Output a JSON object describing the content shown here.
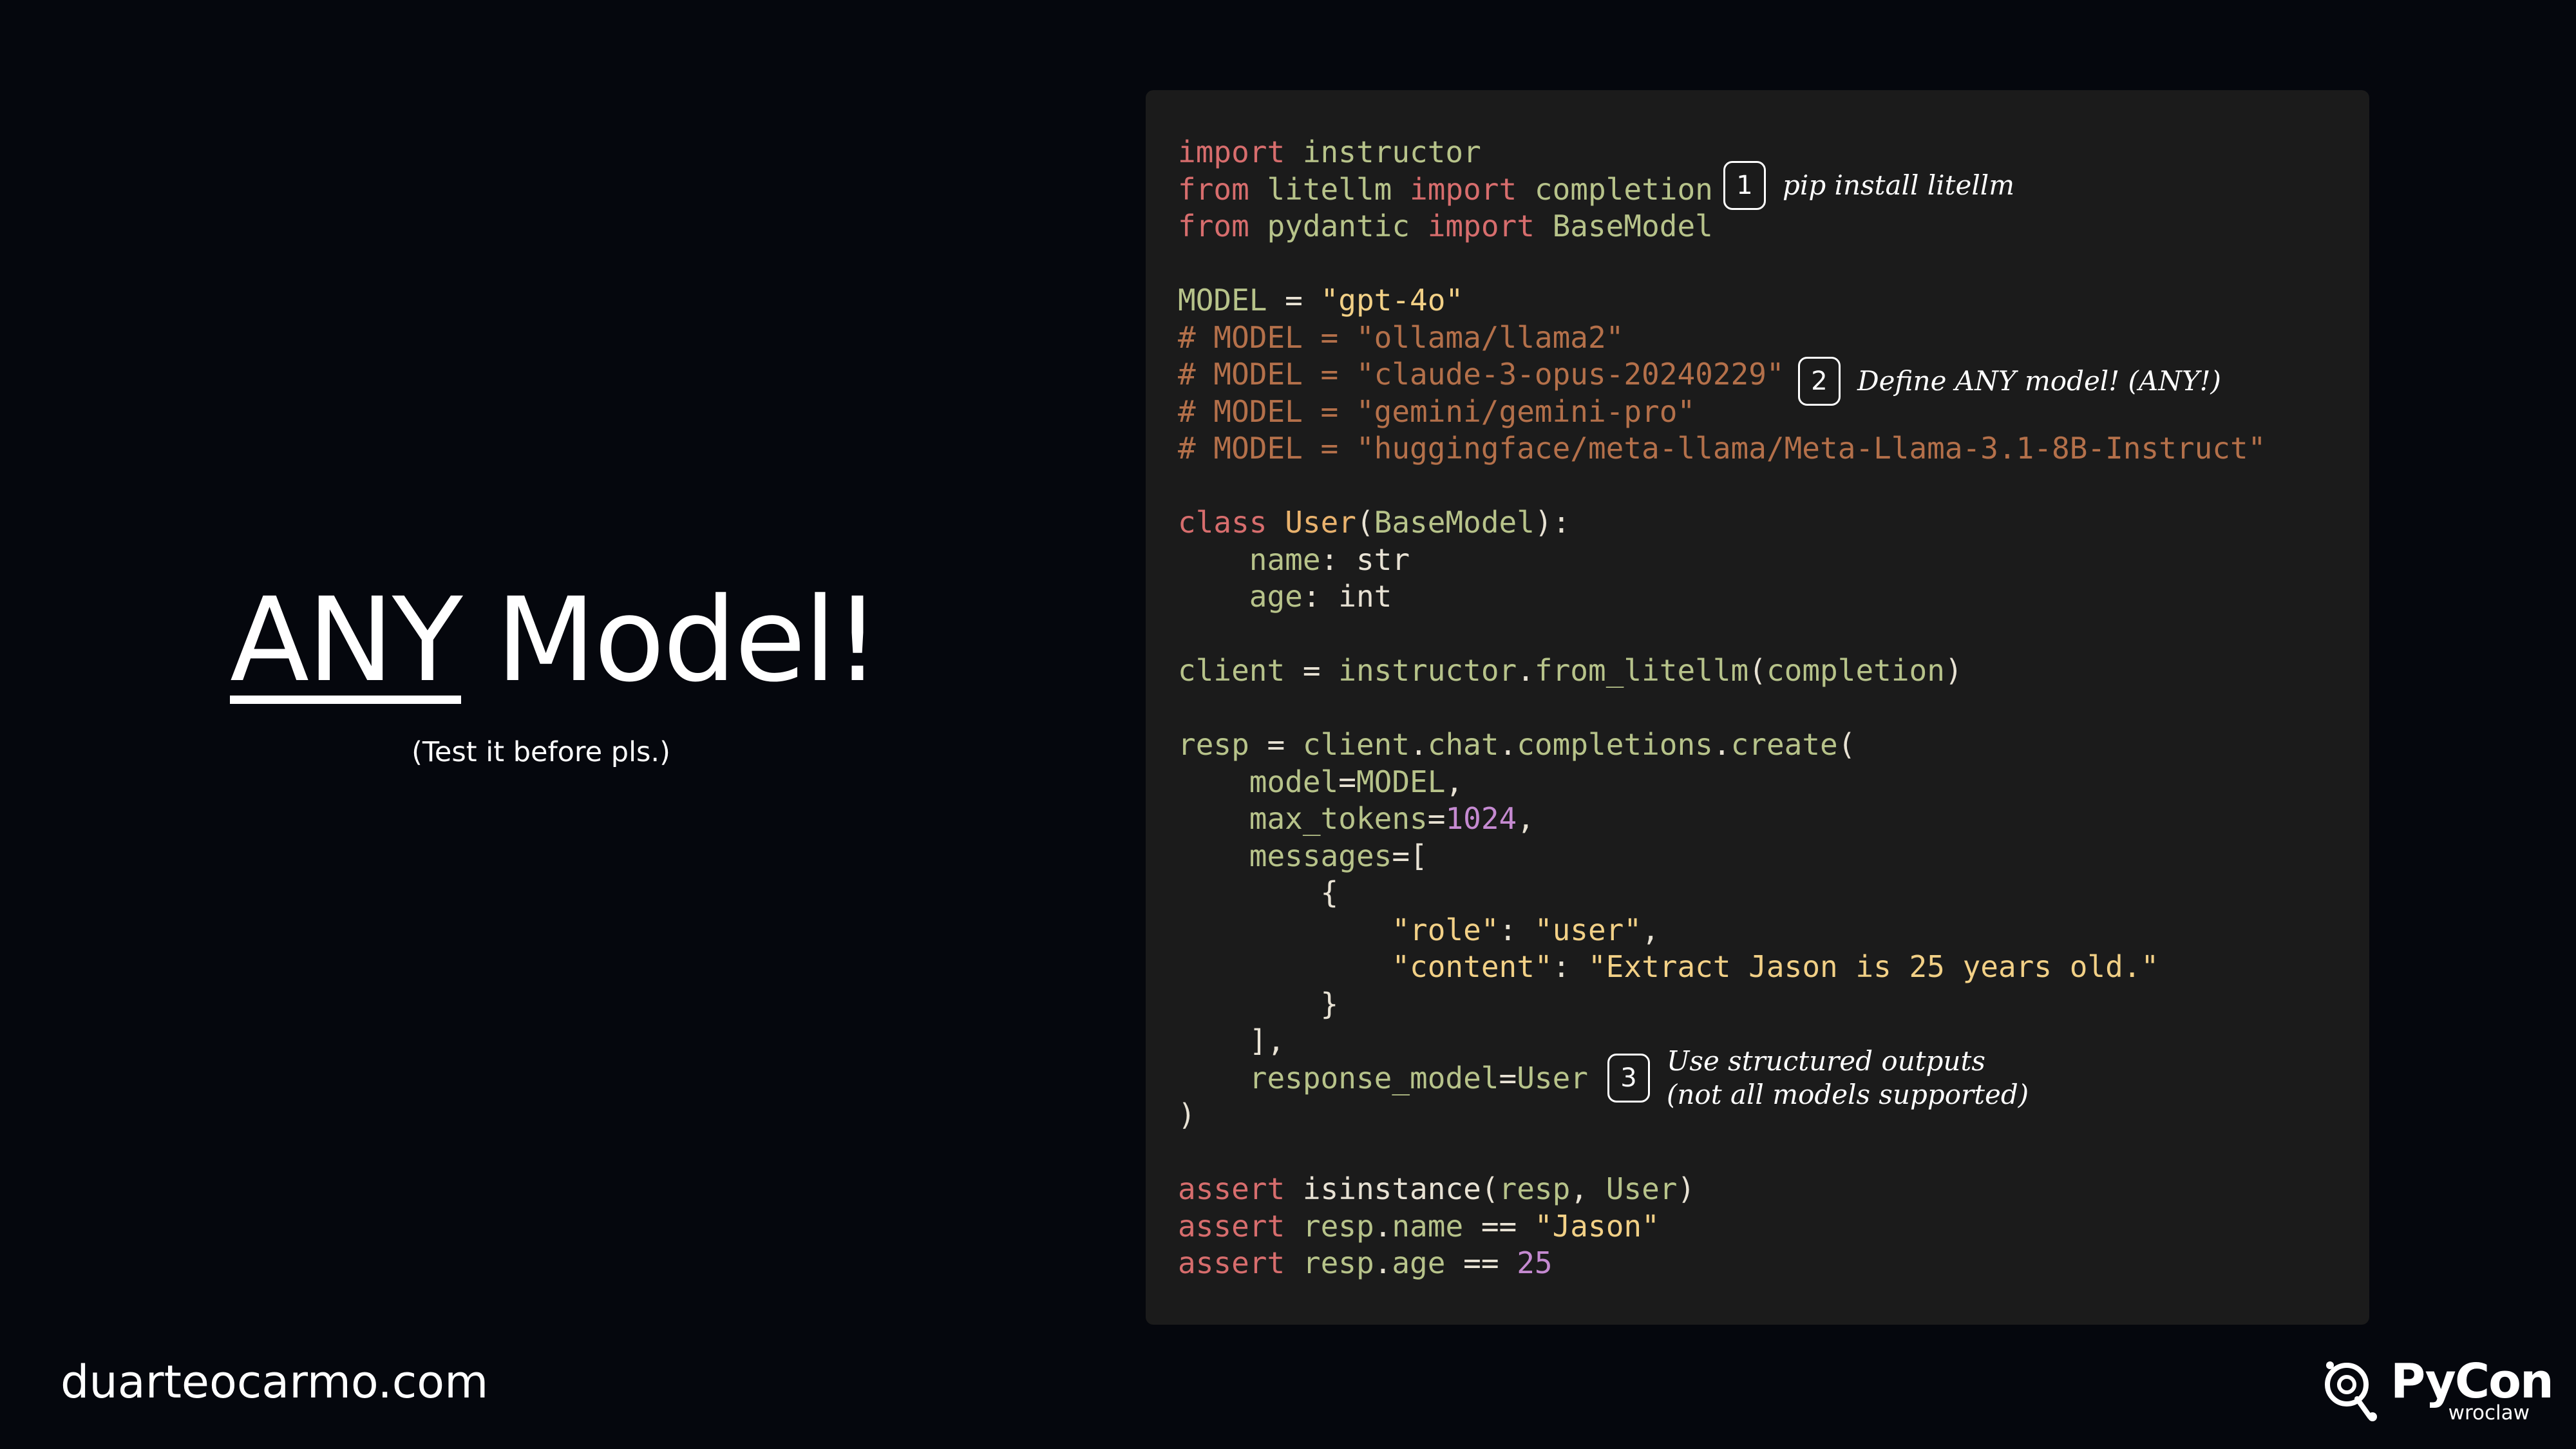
{
  "slide": {
    "title_any": "ANY",
    "title_rest": " Model!",
    "subtitle": "(Test it before pls.)",
    "footer_url": "duarteocarmo.com"
  },
  "logo": {
    "name": "PyCon",
    "city": "wroclaw",
    "icon": "pycon-snake-icon"
  },
  "code": {
    "language": "python",
    "lines": [
      [
        {
          "t": "import",
          "c": "kw"
        },
        {
          "t": " instructor",
          "c": "nm"
        }
      ],
      [
        {
          "t": "from",
          "c": "kw"
        },
        {
          "t": " litellm ",
          "c": "nm"
        },
        {
          "t": "import",
          "c": "kw"
        },
        {
          "t": " completion",
          "c": "nm"
        }
      ],
      [
        {
          "t": "from",
          "c": "kw"
        },
        {
          "t": " pydantic ",
          "c": "nm"
        },
        {
          "t": "import",
          "c": "kw"
        },
        {
          "t": " BaseModel",
          "c": "nm"
        }
      ],
      [],
      [
        {
          "t": "MODEL",
          "c": "nm"
        },
        {
          "t": " = ",
          "c": "pl"
        },
        {
          "t": "\"gpt-4o\"",
          "c": "str"
        }
      ],
      [
        {
          "t": "# MODEL = \"ollama/llama2\"",
          "c": "cm"
        }
      ],
      [
        {
          "t": "# MODEL = \"claude-3-opus-20240229\"",
          "c": "cm"
        }
      ],
      [
        {
          "t": "# MODEL = \"gemini/gemini-pro\"",
          "c": "cm"
        }
      ],
      [
        {
          "t": "# MODEL = \"huggingface/meta-llama/Meta-Llama-3.1-8B-Instruct\"",
          "c": "cm"
        }
      ],
      [],
      [
        {
          "t": "class",
          "c": "kw"
        },
        {
          "t": " ",
          "c": "pl"
        },
        {
          "t": "User",
          "c": "cls"
        },
        {
          "t": "(",
          "c": "pl"
        },
        {
          "t": "BaseModel",
          "c": "nm"
        },
        {
          "t": "):",
          "c": "pl"
        }
      ],
      [
        {
          "t": "    ",
          "c": "pl"
        },
        {
          "t": "name",
          "c": "nm"
        },
        {
          "t": ": str",
          "c": "pl"
        }
      ],
      [
        {
          "t": "    ",
          "c": "pl"
        },
        {
          "t": "age",
          "c": "nm"
        },
        {
          "t": ": int",
          "c": "pl"
        }
      ],
      [],
      [
        {
          "t": "client",
          "c": "nm"
        },
        {
          "t": " = ",
          "c": "pl"
        },
        {
          "t": "instructor",
          "c": "nm"
        },
        {
          "t": ".",
          "c": "pl"
        },
        {
          "t": "from_litellm",
          "c": "nm"
        },
        {
          "t": "(",
          "c": "pl"
        },
        {
          "t": "completion",
          "c": "nm"
        },
        {
          "t": ")",
          "c": "pl"
        }
      ],
      [],
      [
        {
          "t": "resp",
          "c": "nm"
        },
        {
          "t": " = ",
          "c": "pl"
        },
        {
          "t": "client",
          "c": "nm"
        },
        {
          "t": ".",
          "c": "pl"
        },
        {
          "t": "chat",
          "c": "nm"
        },
        {
          "t": ".",
          "c": "pl"
        },
        {
          "t": "completions",
          "c": "nm"
        },
        {
          "t": ".",
          "c": "pl"
        },
        {
          "t": "create",
          "c": "nm"
        },
        {
          "t": "(",
          "c": "pl"
        }
      ],
      [
        {
          "t": "    ",
          "c": "pl"
        },
        {
          "t": "model",
          "c": "nm"
        },
        {
          "t": "=",
          "c": "pl"
        },
        {
          "t": "MODEL",
          "c": "nm"
        },
        {
          "t": ",",
          "c": "pl"
        }
      ],
      [
        {
          "t": "    ",
          "c": "pl"
        },
        {
          "t": "max_tokens",
          "c": "nm"
        },
        {
          "t": "=",
          "c": "pl"
        },
        {
          "t": "1024",
          "c": "num"
        },
        {
          "t": ",",
          "c": "pl"
        }
      ],
      [
        {
          "t": "    ",
          "c": "pl"
        },
        {
          "t": "messages",
          "c": "nm"
        },
        {
          "t": "=[",
          "c": "pl"
        }
      ],
      [
        {
          "t": "        {",
          "c": "pl"
        }
      ],
      [
        {
          "t": "            ",
          "c": "pl"
        },
        {
          "t": "\"role\"",
          "c": "str"
        },
        {
          "t": ": ",
          "c": "pl"
        },
        {
          "t": "\"user\"",
          "c": "str"
        },
        {
          "t": ",",
          "c": "pl"
        }
      ],
      [
        {
          "t": "            ",
          "c": "pl"
        },
        {
          "t": "\"content\"",
          "c": "str"
        },
        {
          "t": ": ",
          "c": "pl"
        },
        {
          "t": "\"Extract Jason is 25 years old.\"",
          "c": "str"
        }
      ],
      [
        {
          "t": "        }",
          "c": "pl"
        }
      ],
      [
        {
          "t": "    ],",
          "c": "pl"
        }
      ],
      [
        {
          "t": "    ",
          "c": "pl"
        },
        {
          "t": "response_model",
          "c": "nm"
        },
        {
          "t": "=",
          "c": "pl"
        },
        {
          "t": "User",
          "c": "nm"
        }
      ],
      [
        {
          "t": ")",
          "c": "pl"
        }
      ],
      [],
      [
        {
          "t": "assert",
          "c": "kw"
        },
        {
          "t": " isinstance(",
          "c": "pl"
        },
        {
          "t": "resp",
          "c": "nm"
        },
        {
          "t": ", ",
          "c": "pl"
        },
        {
          "t": "User",
          "c": "nm"
        },
        {
          "t": ")",
          "c": "pl"
        }
      ],
      [
        {
          "t": "assert",
          "c": "kw"
        },
        {
          "t": " ",
          "c": "pl"
        },
        {
          "t": "resp",
          "c": "nm"
        },
        {
          "t": ".",
          "c": "pl"
        },
        {
          "t": "name",
          "c": "nm"
        },
        {
          "t": " == ",
          "c": "pl"
        },
        {
          "t": "\"Jason\"",
          "c": "str"
        }
      ],
      [
        {
          "t": "assert",
          "c": "kw"
        },
        {
          "t": " ",
          "c": "pl"
        },
        {
          "t": "resp",
          "c": "nm"
        },
        {
          "t": ".",
          "c": "pl"
        },
        {
          "t": "age",
          "c": "nm"
        },
        {
          "t": " == ",
          "c": "pl"
        },
        {
          "t": "25",
          "c": "num"
        }
      ]
    ]
  },
  "annotations": [
    {
      "badge": "1",
      "lines": [
        "pip install litellm"
      ]
    },
    {
      "badge": "2",
      "lines": [
        "Define ANY model! (ANY!)"
      ]
    },
    {
      "badge": "3",
      "lines": [
        "Use structured outputs",
        "(not all models supported)"
      ]
    }
  ],
  "colors": {
    "background": "#05070d",
    "code_panel": "#1b1b1b",
    "keyword": "#d76d6d",
    "name": "#b7c38a",
    "string": "#f2d086",
    "comment": "#b4704a",
    "number": "#c58ad1"
  }
}
